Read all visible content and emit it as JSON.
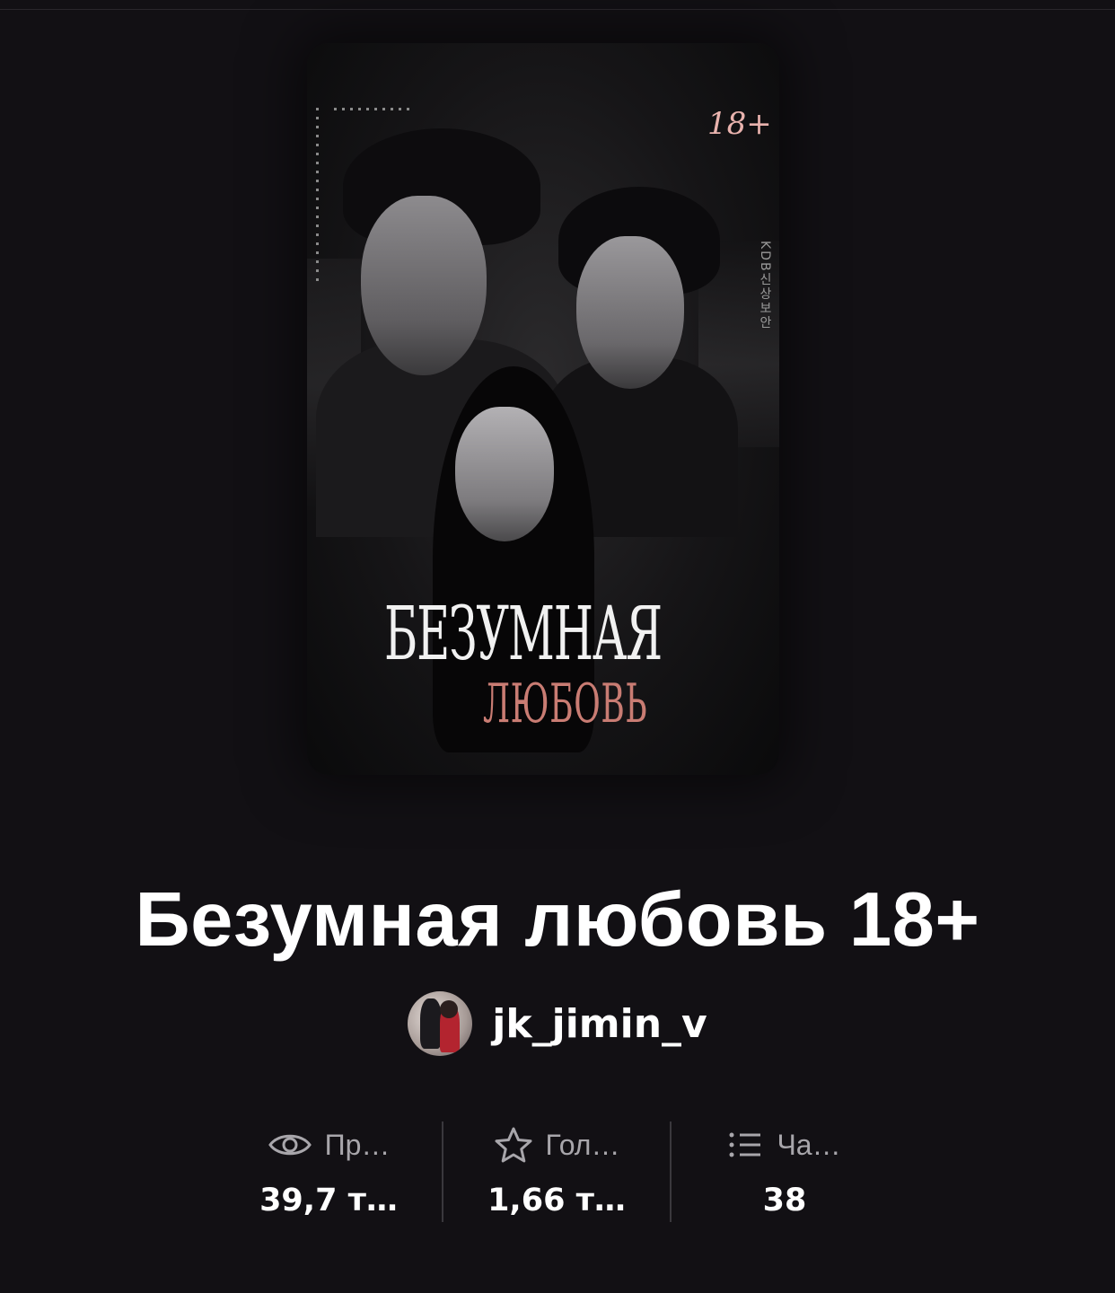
{
  "cover": {
    "age_badge": "18+",
    "title_line1": "БЕЗУМНАЯ",
    "title_line2": "ЛЮБОВЬ",
    "vertical_text": "KDB신상보안"
  },
  "book": {
    "title": "Безумная любовь 18+"
  },
  "author": {
    "name": "jk_jimin_v"
  },
  "stats": [
    {
      "icon": "eye-icon",
      "label": "Пр…",
      "value": "39,7 т…"
    },
    {
      "icon": "star-icon",
      "label": "Гол…",
      "value": "1,66 т…"
    },
    {
      "icon": "list-icon",
      "label": "Ча…",
      "value": "38"
    }
  ],
  "colors": {
    "background": "#121014",
    "cover_title_accent": "#c97c73",
    "age_badge": "#e9b3ae",
    "stat_label": "#a8a6ab"
  }
}
